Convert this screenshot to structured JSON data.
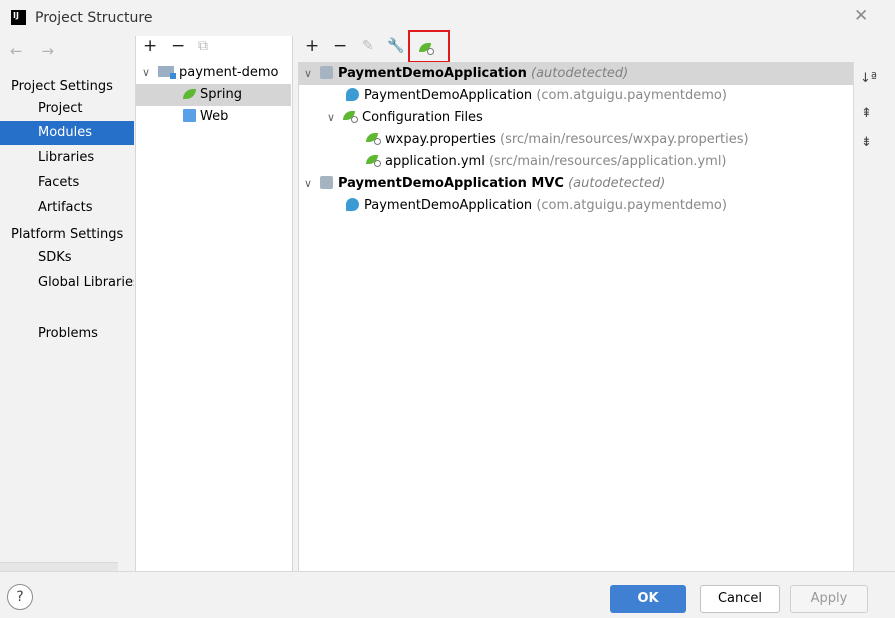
{
  "window": {
    "title": "Project Structure",
    "close_glyph": "✕",
    "logo_text": "IJ"
  },
  "nav": {
    "back_forward": "← →",
    "project_settings_label": "Project Settings",
    "platform_settings_label": "Platform Settings",
    "items": {
      "project": "Project",
      "modules": "Modules",
      "libraries": "Libraries",
      "facets": "Facets",
      "artifacts": "Artifacts",
      "sdks": "SDKs",
      "global_libraries": "Global Libraries",
      "problems": "Problems"
    },
    "selected": "Modules"
  },
  "tree_toolbar": {
    "add": "+",
    "remove": "−",
    "copy": "⧉"
  },
  "module_tree": {
    "root": "payment-demo",
    "children": [
      "Spring",
      "Web"
    ],
    "selected": "Spring"
  },
  "facet_toolbar": {
    "add": "+",
    "remove": "−",
    "edit": "✎",
    "wrench": "🔧"
  },
  "facet_tree": {
    "ctx1": {
      "name": "PaymentDemoApplication",
      "tag": "(autodetected)"
    },
    "ctx1_app": {
      "name": "PaymentDemoApplication",
      "pkg": "(com.atguigu.paymentdemo)"
    },
    "config_files": "Configuration Files",
    "files": [
      {
        "name": "wxpay.properties",
        "path": "(src/main/resources/wxpay.properties)"
      },
      {
        "name": "application.yml",
        "path": "(src/main/resources/application.yml)"
      }
    ],
    "ctx2": {
      "name": "PaymentDemoApplication MVC",
      "tag": "(autodetected)"
    },
    "ctx2_app": {
      "name": "PaymentDemoApplication",
      "pkg": "(com.atguigu.paymentdemo)"
    }
  },
  "gutter": {
    "sort": "↓ª",
    "expand": "⇞",
    "collapse": "⇟"
  },
  "footer": {
    "help": "?",
    "ok": "OK",
    "cancel": "Cancel",
    "apply": "Apply"
  },
  "colors": {
    "accent": "#2770c9",
    "ok_button": "#3f80d2",
    "highlight_box": "#e0191b",
    "spring_green": "#5fb832"
  }
}
